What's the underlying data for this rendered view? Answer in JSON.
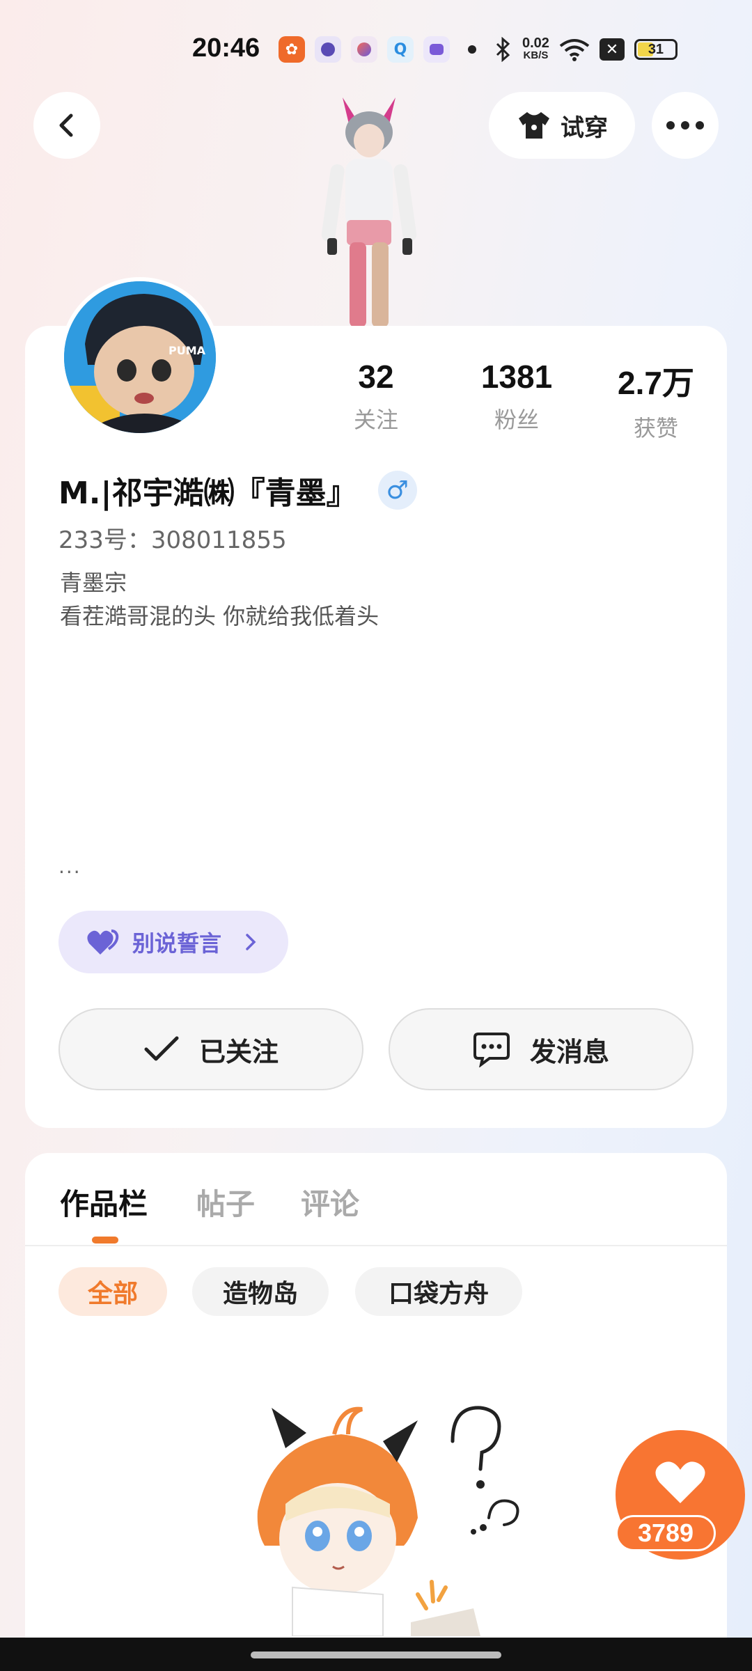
{
  "status_bar": {
    "time": "20:46",
    "net_speed_value": "0.02",
    "net_speed_unit": "KB/S",
    "battery": "31",
    "icons": [
      "app-icon-orange",
      "app-icon-purple",
      "app-icon-multicolor",
      "search-app-icon",
      "app-icon-violet",
      "dot-icon",
      "bluetooth-icon",
      "wifi-icon",
      "close-box-icon",
      "battery-icon"
    ]
  },
  "header": {
    "try_on_label": "试穿"
  },
  "profile": {
    "username": "M.|祁宇澔㈱『青墨』",
    "gender_symbol": "♂",
    "uid": "233号：308011855",
    "bio_line1": "青墨宗",
    "bio_line2": "看茬澔哥混的头 你就给我低着头",
    "ellipsis": "···",
    "stats": [
      {
        "value": "32",
        "label": "关注"
      },
      {
        "value": "1381",
        "label": "粉丝"
      },
      {
        "value": "2.7万",
        "label": "获赞"
      }
    ],
    "tag_label": "别说誓言",
    "follow_label": "已关注",
    "message_label": "发消息"
  },
  "content": {
    "tabs": [
      "作品栏",
      "帖子",
      "评论"
    ],
    "active_tab": "作品栏",
    "chips": [
      "全部",
      "造物岛",
      "口袋方舟"
    ],
    "active_chip": "全部"
  },
  "like": {
    "count": "3789"
  },
  "colors": {
    "accent": "#f07a2c",
    "like_fab": "#f87532",
    "tag_text": "#6b63d6",
    "tag_bg": "#ebe8fb"
  }
}
